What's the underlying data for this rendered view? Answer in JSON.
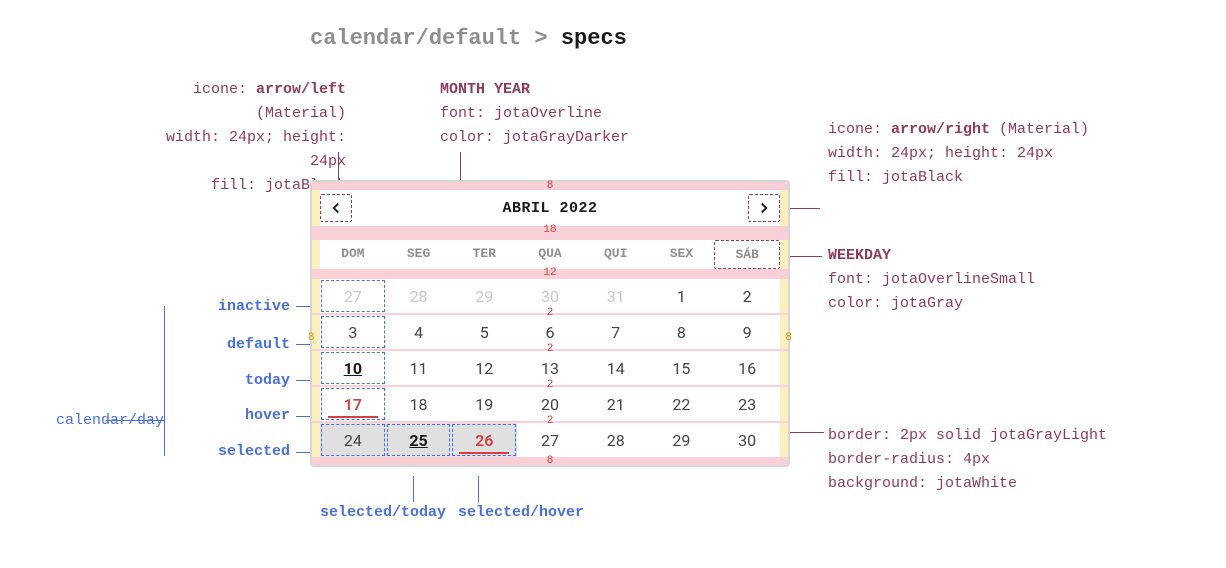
{
  "breadcrumb": {
    "dim": "calendar/default >",
    "strong": "specs"
  },
  "annotations": {
    "arrowLeft": {
      "l1a": "icone: ",
      "l1b": "arrow/left",
      "l1c": " (Material)",
      "l2": "width: 24px; height: 24px",
      "l3": "fill: jotaBlack"
    },
    "arrowRight": {
      "l1a": "icone: ",
      "l1b": "arrow/right",
      "l1c": " (Material)",
      "l2": "width: 24px; height: 24px",
      "l3": "fill: jotaBlack"
    },
    "monthYear": {
      "title": "MONTH YEAR",
      "l2": "font: jotaOverline",
      "l3": "color: jotaGrayDarker"
    },
    "weekday": {
      "title": "WEEKDAY",
      "l2": "font: jotaOverlineSmall",
      "l3": "color: jotaGray"
    },
    "border": {
      "l1": "border: 2px solid jotaGrayLight",
      "l2": "border-radius: 4px",
      "l3": "background: jotaWhite"
    }
  },
  "callouts": {
    "inactive": "inactive",
    "default": "default",
    "today": "today",
    "hover": "hover",
    "selected": "selected",
    "category": "calendar/day",
    "selectedToday": "selected/today",
    "selectedHover": "selected/hover"
  },
  "spacing": {
    "s1": "8",
    "s2": "18",
    "s3": "12",
    "s4": "2",
    "s5": "8",
    "side": "8"
  },
  "calendar": {
    "title": "ABRIL 2022",
    "weekdays": [
      "DOM",
      "SEG",
      "TER",
      "QUA",
      "QUI",
      "SEX",
      "SÁB"
    ],
    "rows": [
      [
        {
          "n": "27",
          "cls": "inactive mark"
        },
        {
          "n": "28",
          "cls": "inactive"
        },
        {
          "n": "29",
          "cls": "inactive"
        },
        {
          "n": "30",
          "cls": "inactive"
        },
        {
          "n": "31",
          "cls": "inactive"
        },
        {
          "n": "1",
          "cls": ""
        },
        {
          "n": "2",
          "cls": ""
        }
      ],
      [
        {
          "n": "3",
          "cls": "mark"
        },
        {
          "n": "4",
          "cls": ""
        },
        {
          "n": "5",
          "cls": ""
        },
        {
          "n": "6",
          "cls": ""
        },
        {
          "n": "7",
          "cls": ""
        },
        {
          "n": "8",
          "cls": ""
        },
        {
          "n": "9",
          "cls": ""
        }
      ],
      [
        {
          "n": "10",
          "cls": "today mark"
        },
        {
          "n": "11",
          "cls": ""
        },
        {
          "n": "12",
          "cls": ""
        },
        {
          "n": "13",
          "cls": ""
        },
        {
          "n": "14",
          "cls": ""
        },
        {
          "n": "15",
          "cls": ""
        },
        {
          "n": "16",
          "cls": ""
        }
      ],
      [
        {
          "n": "17",
          "cls": "hover mark"
        },
        {
          "n": "18",
          "cls": ""
        },
        {
          "n": "19",
          "cls": ""
        },
        {
          "n": "20",
          "cls": ""
        },
        {
          "n": "21",
          "cls": ""
        },
        {
          "n": "22",
          "cls": ""
        },
        {
          "n": "23",
          "cls": ""
        }
      ],
      [
        {
          "n": "24",
          "cls": "selected mark"
        },
        {
          "n": "25",
          "cls": "selected today mark"
        },
        {
          "n": "26",
          "cls": "selected hover mark"
        },
        {
          "n": "27",
          "cls": ""
        },
        {
          "n": "28",
          "cls": ""
        },
        {
          "n": "29",
          "cls": ""
        },
        {
          "n": "30",
          "cls": ""
        }
      ]
    ]
  }
}
